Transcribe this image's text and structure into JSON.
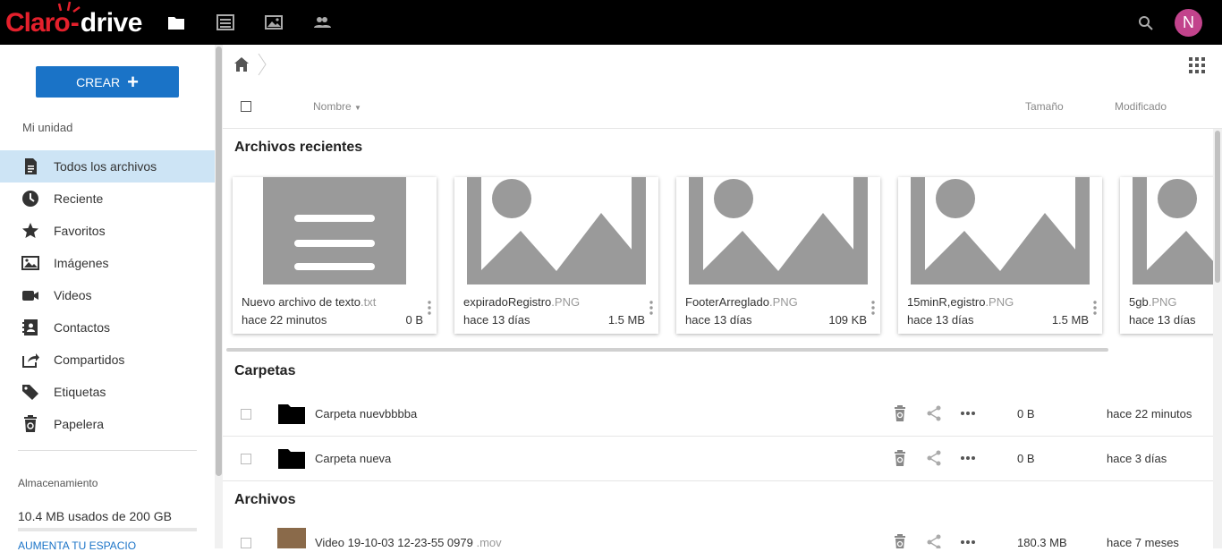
{
  "app": {
    "logo_claro": "Claro",
    "logo_drive": "drive",
    "avatar_initial": "N",
    "brand_color": "#e4202c",
    "accent_color": "#1a73c7"
  },
  "topnav": {
    "icons": [
      "folder-icon",
      "list-icon",
      "image-icon",
      "people-icon",
      "search-icon"
    ]
  },
  "sidebar": {
    "create_label": "CREAR",
    "section_label": "Mi unidad",
    "items": [
      {
        "label": "Todos los archivos",
        "icon": "document-icon",
        "active": true
      },
      {
        "label": "Reciente",
        "icon": "clock-icon"
      },
      {
        "label": "Favoritos",
        "icon": "star-icon"
      },
      {
        "label": "Imágenes",
        "icon": "image-icon"
      },
      {
        "label": "Videos",
        "icon": "video-icon"
      },
      {
        "label": "Contactos",
        "icon": "contacts-icon"
      },
      {
        "label": "Compartidos",
        "icon": "share-icon"
      },
      {
        "label": "Etiquetas",
        "icon": "tag-icon"
      },
      {
        "label": "Papelera",
        "icon": "trash-icon"
      }
    ],
    "storage_title": "Almacenamiento",
    "storage_used": "10.4 MB usados de 200 GB",
    "storage_link": "AUMENTA TU ESPACIO"
  },
  "header": {
    "name": "Nombre",
    "size": "Tamaño",
    "modified": "Modificado"
  },
  "recent": {
    "title": "Archivos recientes",
    "cards": [
      {
        "name": "Nuevo archivo de texto",
        "ext": ".txt",
        "date": "hace 22 minutos",
        "size": "0 B",
        "kind": "text"
      },
      {
        "name": "expiradoRegistro",
        "ext": ".PNG",
        "date": "hace 13 días",
        "size": "1.5 MB",
        "kind": "image"
      },
      {
        "name": "FooterArreglado",
        "ext": ".PNG",
        "date": "hace 13 días",
        "size": "109 KB",
        "kind": "image"
      },
      {
        "name": "15minR,egistro",
        "ext": ".PNG",
        "date": "hace 13 días",
        "size": "1.5 MB",
        "kind": "image"
      },
      {
        "name": "5gb",
        "ext": ".PNG",
        "date": "hace 13 días",
        "size": "",
        "kind": "image"
      }
    ]
  },
  "folders": {
    "title": "Carpetas",
    "rows": [
      {
        "name": "Carpeta nuevbbbba",
        "size": "0 B",
        "modified": "hace 22 minutos"
      },
      {
        "name": "Carpeta nueva",
        "size": "0 B",
        "modified": "hace 3 días"
      }
    ]
  },
  "files": {
    "title": "Archivos",
    "rows": [
      {
        "name": "Video 19-10-03 12-23-55 0979",
        "ext": ".mov",
        "size": "180.3 MB",
        "modified": "hace 7 meses"
      }
    ]
  }
}
